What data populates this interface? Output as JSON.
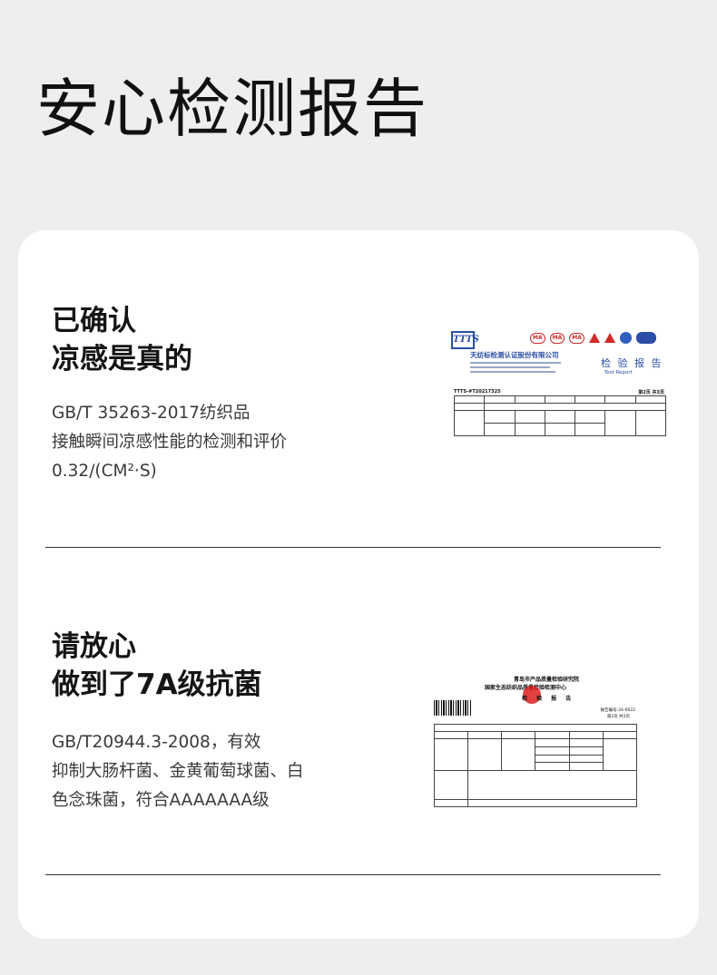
{
  "page": {
    "title": "安心检测报告"
  },
  "sections": [
    {
      "heading_lines": [
        "已确认",
        "凉感是真的"
      ],
      "desc_lines": [
        "GB/T 35263-2017纺织品",
        "接触瞬间凉感性能的检测和评价",
        "0.32/(CM²·S)"
      ],
      "certificate": {
        "logo_text": "TTTS",
        "marks": [
          "MA",
          "MA",
          "MA",
          "CNAS"
        ],
        "company": "天纺标检测认证股份有限公司",
        "report_title": "检 验 报 告",
        "report_subtitle": "Test Report",
        "cert_no": "TTTS-#T20217325",
        "page_no": "第2页 共3页"
      }
    },
    {
      "heading_lines": [
        "请放心",
        "做到了7A级抗菌"
      ],
      "desc_lines": [
        "GB/T20944.3-2008，有效",
        "抑制大肠杆菌、金黄葡萄球菌、白",
        "色念珠菌，符合AAAAAAA级"
      ],
      "certificate": {
        "institute_line1": "青岛市产品质量检验研究院",
        "institute_line2": "国家生态纺织品质量检验检测中心",
        "report_title": "检 验 报 告",
        "report_no": "报告编号:24-0622",
        "page_no": "第2页 共3页"
      }
    }
  ],
  "colors": {
    "background": "#eeeeee",
    "card": "#ffffff",
    "cert_blue": "#2b4fa6",
    "stamp_red": "#d12a2a"
  }
}
